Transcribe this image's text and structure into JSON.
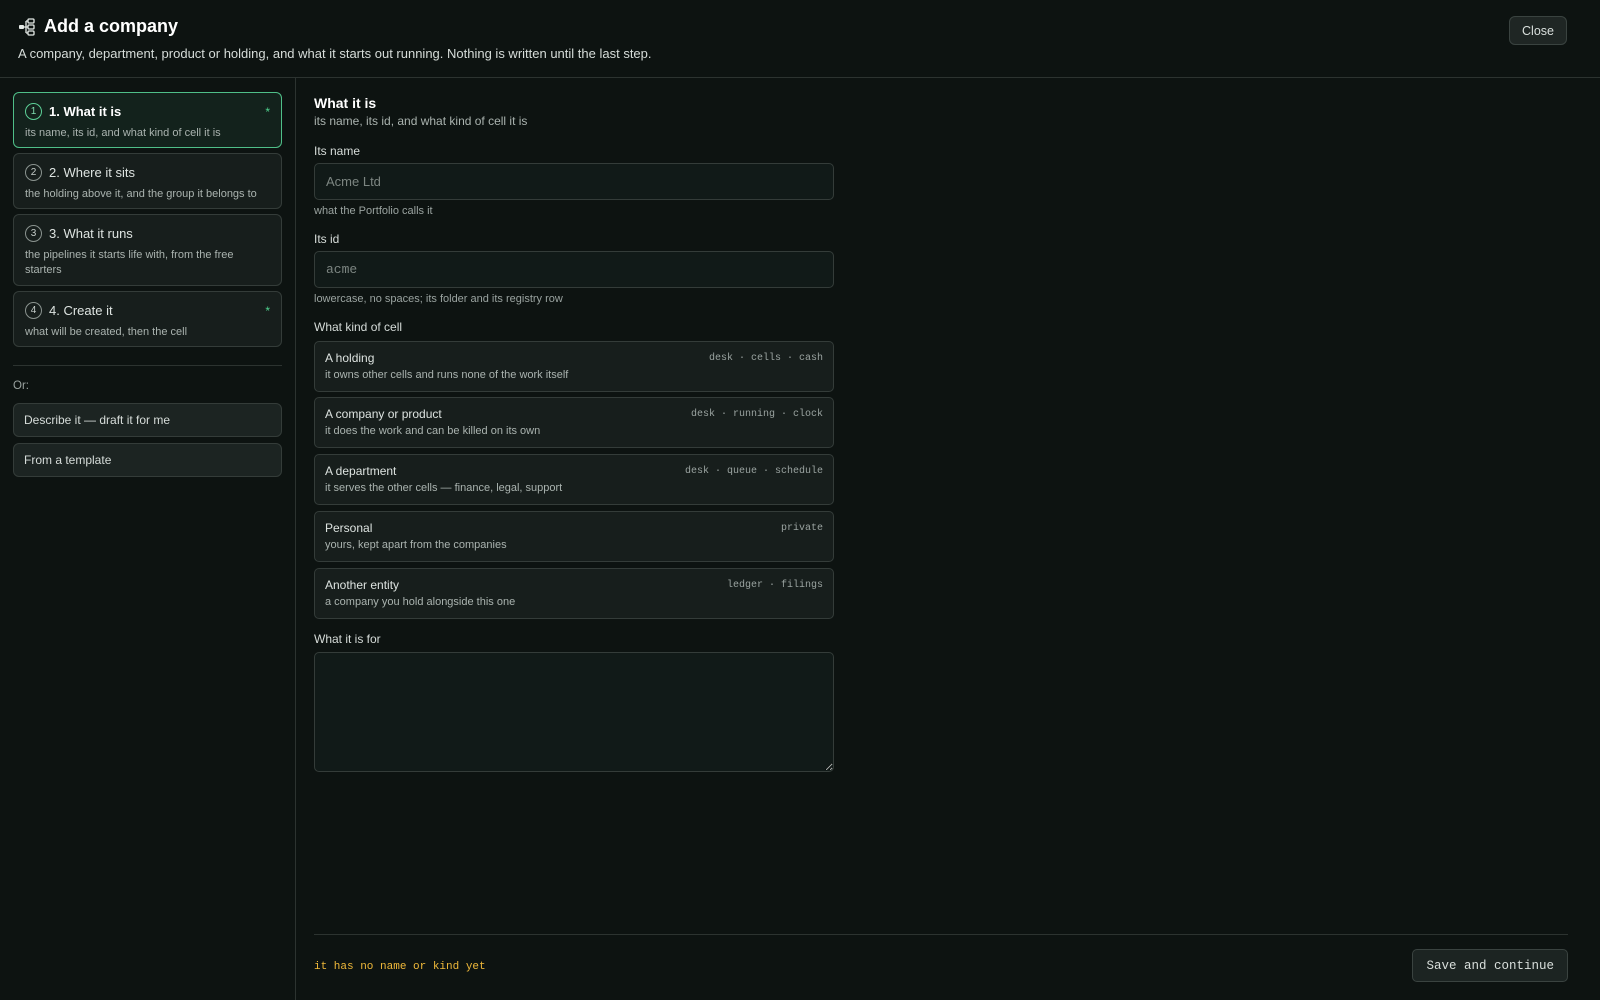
{
  "header": {
    "title": "Add a company",
    "subtitle": "A company, department, product or holding, and what it starts out running. Nothing is written until the last step.",
    "close_label": "Close",
    "icon": "org-chart-icon"
  },
  "sidebar": {
    "steps": [
      {
        "num": "1",
        "title": "1. What it is",
        "desc": "its name, its id, and what kind of cell it is",
        "required": "*",
        "active": true
      },
      {
        "num": "2",
        "title": "2. Where it sits",
        "desc": "the holding above it, and the group it belongs to",
        "required": "",
        "active": false
      },
      {
        "num": "3",
        "title": "3. What it runs",
        "desc": "the pipelines it starts life with, from the free starters",
        "required": "",
        "active": false
      },
      {
        "num": "4",
        "title": "4. Create it",
        "desc": "what will be created, then the cell",
        "required": "*",
        "active": false
      }
    ],
    "or_label": "Or:",
    "alt_actions": [
      {
        "label": "Describe it — draft it for me"
      },
      {
        "label": "From a template"
      }
    ]
  },
  "main": {
    "section_title": "What it is",
    "section_sub": "its name, its id, and what kind of cell it is",
    "name_field": {
      "label": "Its name",
      "placeholder": "Acme Ltd",
      "value": "",
      "hint": "what the Portfolio calls it"
    },
    "id_field": {
      "label": "Its id",
      "placeholder": "acme",
      "value": "",
      "hint": "lowercase, no spaces; its folder and its registry row"
    },
    "kind_label": "What kind of cell",
    "kinds": [
      {
        "title": "A holding",
        "desc": "it owns other cells and runs none of the work itself",
        "tags": "desk · cells · cash"
      },
      {
        "title": "A company or product",
        "desc": "it does the work and can be killed on its own",
        "tags": "desk · running · clock"
      },
      {
        "title": "A department",
        "desc": "it serves the other cells — finance, legal, support",
        "tags": "desk · queue · schedule"
      },
      {
        "title": "Personal",
        "desc": "yours, kept apart from the companies",
        "tags": "private"
      },
      {
        "title": "Another entity",
        "desc": "a company you hold alongside this one",
        "tags": "ledger · filings"
      }
    ],
    "purpose_label": "What it is for",
    "purpose_value": ""
  },
  "footer": {
    "status": "it has no name or kind yet",
    "save_label": "Save and continue"
  },
  "colors": {
    "background": "#0d1311",
    "accent": "#4fbf88",
    "warning": "#f0b93a"
  }
}
